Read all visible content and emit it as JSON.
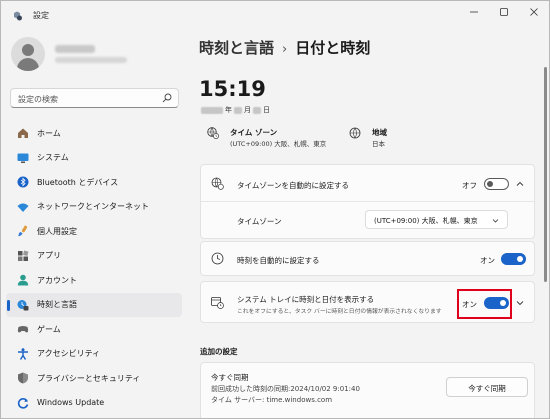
{
  "window": {
    "title": "設定"
  },
  "search": {
    "placeholder": "設定の検索"
  },
  "sidebar": {
    "items": [
      {
        "label": "ホーム",
        "icon": "home-icon"
      },
      {
        "label": "システム",
        "icon": "system-icon"
      },
      {
        "label": "Bluetooth とデバイス",
        "icon": "bluetooth-icon"
      },
      {
        "label": "ネットワークとインターネット",
        "icon": "wifi-icon"
      },
      {
        "label": "個人用設定",
        "icon": "brush-icon"
      },
      {
        "label": "アプリ",
        "icon": "apps-icon"
      },
      {
        "label": "アカウント",
        "icon": "account-icon"
      },
      {
        "label": "時刻と言語",
        "icon": "time-language-icon",
        "active": true
      },
      {
        "label": "ゲーム",
        "icon": "gamepad-icon"
      },
      {
        "label": "アクセシビリティ",
        "icon": "accessibility-icon"
      },
      {
        "label": "プライバシーとセキュリティ",
        "icon": "shield-icon"
      },
      {
        "label": "Windows Update",
        "icon": "windows-update-icon"
      }
    ]
  },
  "breadcrumb": {
    "parent": "時刻と言語",
    "separator": "›",
    "current": "日付と時刻"
  },
  "clock": {
    "time": "15:19",
    "year_suffix": "年",
    "month_suffix": "月",
    "day_suffix": "日"
  },
  "timezone_info": {
    "title": "タイム ゾーン",
    "value": "(UTC+09:00) 大阪、札幌、東京"
  },
  "region_info": {
    "title": "地域",
    "value": "日本"
  },
  "auto_timezone": {
    "label": "タイムゾーンを自動的に設定する",
    "state": "オフ"
  },
  "timezone_select": {
    "label": "タイムゾーン",
    "value": "(UTC+09:00) 大阪、札幌、東京"
  },
  "auto_time": {
    "label": "時刻を自動的に設定する",
    "state": "オン"
  },
  "systray": {
    "label": "システム トレイに時刻と日付を表示する",
    "sub": "これをオフにすると、タスク バーに時刻と日付の情報が表示されなくなります",
    "state": "オン"
  },
  "additional": {
    "title": "追加の設定",
    "sync_title": "今すぐ同期",
    "last_sync": "前回成功した時刻の同期:2024/10/02 9:01:40",
    "server": "タイム サーバー: time.windows.com",
    "sync_button": "今すぐ同期"
  },
  "colors": {
    "accent": "#1a63c8",
    "highlight": "#e0001b"
  }
}
